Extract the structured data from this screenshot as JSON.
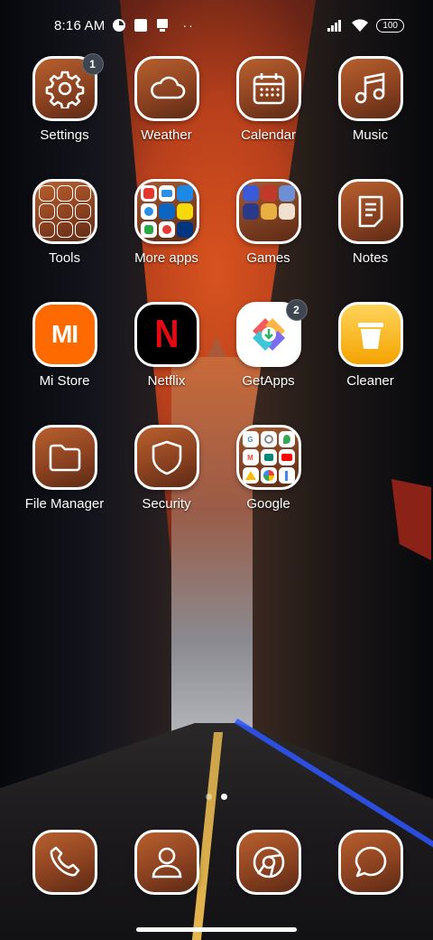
{
  "status_bar": {
    "time": "8:16 AM",
    "battery": "100",
    "overflow": "··"
  },
  "apps": [
    {
      "id": "settings",
      "label": "Settings",
      "icon": "gear-icon",
      "badge": "1"
    },
    {
      "id": "weather",
      "label": "Weather",
      "icon": "cloud-icon"
    },
    {
      "id": "calendar",
      "label": "Calendar",
      "icon": "calendar-icon"
    },
    {
      "id": "music",
      "label": "Music",
      "icon": "music-note-icon"
    },
    {
      "id": "tools",
      "label": "Tools",
      "icon": "tools-folder-icon"
    },
    {
      "id": "more-apps",
      "label": "More apps",
      "icon": "folder-icon"
    },
    {
      "id": "games",
      "label": "Games",
      "icon": "folder-icon"
    },
    {
      "id": "notes",
      "label": "Notes",
      "icon": "note-icon"
    },
    {
      "id": "mi-store",
      "label": "Mi Store",
      "icon": "mi-logo-icon",
      "logo_text": "MI"
    },
    {
      "id": "netflix",
      "label": "Netflix",
      "icon": "netflix-logo-icon",
      "logo_text": "N"
    },
    {
      "id": "getapps",
      "label": "GetApps",
      "icon": "getapps-icon",
      "badge": "2"
    },
    {
      "id": "cleaner",
      "label": "Cleaner",
      "icon": "trash-can-icon"
    },
    {
      "id": "file-manager",
      "label": "File Manager",
      "icon": "folder-outline-icon"
    },
    {
      "id": "security",
      "label": "Security",
      "icon": "shield-icon"
    },
    {
      "id": "google",
      "label": "Google",
      "icon": "folder-icon"
    }
  ],
  "dock": [
    {
      "id": "phone",
      "icon": "phone-icon"
    },
    {
      "id": "contacts",
      "icon": "person-icon"
    },
    {
      "id": "browser",
      "icon": "chrome-icon"
    },
    {
      "id": "messages",
      "icon": "chat-bubble-icon"
    }
  ],
  "pager": {
    "pages": 2,
    "active": 2
  },
  "colors": {
    "tile_gradient_start": "#b8602e",
    "tile_gradient_end": "#5c2a16",
    "badge": "#3e4652",
    "mi_orange": "#ff6a00",
    "netflix_red": "#e50914",
    "cleaner_yellow": "#f4a300"
  }
}
